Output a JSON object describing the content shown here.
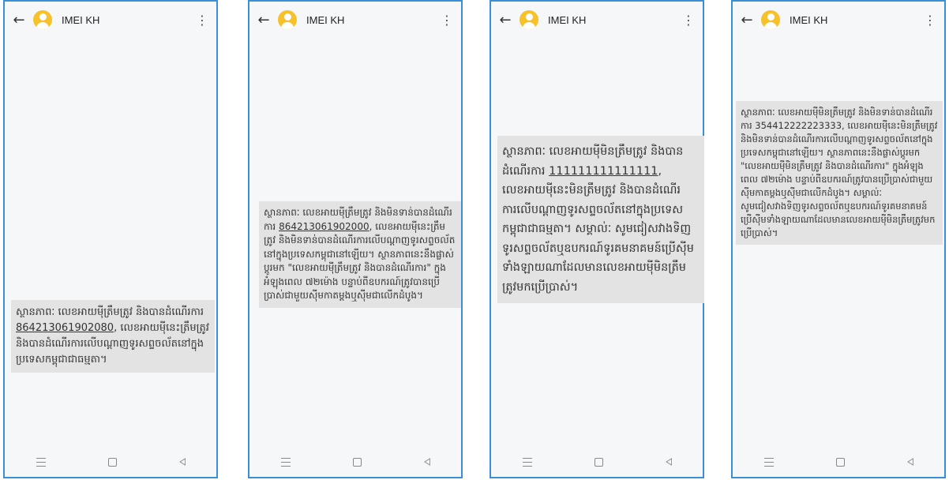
{
  "phones": [
    {
      "title": "IMEI KH",
      "message": {
        "before": "ស្ថានភាពៈ លេខអាយម៉ីត្រឹមត្រូវ និងបានដំណើរការ ",
        "number": "864213061902080",
        "after": ", លេខអាយម៉ីនេះត្រឹមត្រូវ និងបានដំណើរការលើបណ្តាញទូរសព្ទចល័តនៅក្នុងប្រទេសកម្ពុជាជាធម្មតា។"
      }
    },
    {
      "title": "IMEI KH",
      "message": {
        "before": "ស្ថានភាពៈ លេខអាយម៉ីត្រឹមត្រូវ និងមិនទាន់បានដំណើរការ ",
        "number": "864213061902000",
        "after": ", លេខអាយម៉ីនេះត្រឹមត្រូវ និងមិនទាន់បានដំណើរការលើបណ្តាញទូរសព្ទចល័តនៅក្នុងប្រទេសកម្ពុជានៅឡើយ។ ស្ថានភាពនេះនឹងផ្លាស់ប្តូរមក \"លេខអាយម៉ីត្រឹមត្រូវ និងបានដំណើរការ\" ក្នុងអំឡុងពេល ៧២ម៉ោង បន្ទាប់ពីឧបករណ៍ត្រូវបានប្រើប្រាស់ជាមួយស៊ីមកាតម្ដងឬស៊ីមជាលើកដំបូង។"
      }
    },
    {
      "title": "IMEI KH",
      "message": {
        "before": "ស្ថានភាពៈ លេខអាយម៉ីមិនត្រឹមត្រូវ និងបានដំណើរការ ",
        "number": "111111111111111",
        "after": ", លេខអាយម៉ីនេះមិនត្រឹមត្រូវ និងបានដំណើរការលើបណ្តាញទូរសព្ទចល័តនៅក្នុងប្រទេសកម្ពុជាជាធម្មតា។ សម្គាល់ៈ សូមជៀសវាងទិញទូរសព្ទចល័តឬឧបករណ៍ទូរគមនាគមន៍ប្រើស៊ីមទាំងឡាយណាដែលមានលេខអាយម៉ីមិនត្រឹមត្រូវមកប្រើប្រាស់។"
      }
    },
    {
      "title": "IMEI KH",
      "message": {
        "before": "ស្ថានភាពៈ លេខអាយម៉ីមិនត្រឹមត្រូវ និងមិនទាន់បានដំណើរការ ",
        "number": "354412222223333",
        "after": ", លេខអាយម៉ីនេះមិនត្រឹមត្រូវ និងមិនទាន់បានដំណើរការលើបណ្តាញទូរសព្ទចល័តនៅក្នុងប្រទេសកម្ពុជានៅឡើយ។ ស្ថានភាពនេះនឹងផ្លាស់ប្តូរមក \"លេខអាយម៉ីមិនត្រឹមត្រូវ និងបានដំណើរការ\" ក្នុងអំឡុងពេល ៧២ម៉ោង បន្ទាប់ពីឧបករណ៍ត្រូវបានប្រើប្រាស់ជាមួយស៊ីមកាតម្ដងឬស៊ីមជាលើកដំបូង។ សម្គាល់ៈ សូមជៀសវាងទិញទូរសព្ទចល័តឬឧបករណ៍ទូរគមនាគមន៍ប្រើស៊ីមទាំងឡាយណាដែលមានលេខអាយម៉ីមិនត្រឹមត្រូវមកប្រើប្រាស់។"
      }
    }
  ],
  "icons": {
    "back": "arrow-left-icon",
    "avatar": "contact-avatar-icon",
    "menu": "more-vertical-icon",
    "nav_recent": "recent-apps-icon",
    "nav_home": "home-icon",
    "nav_back": "nav-back-icon"
  },
  "colors": {
    "avatar": "#f6c12a",
    "frame": "#3b8fd6",
    "bubble": "#e3e3e3"
  }
}
